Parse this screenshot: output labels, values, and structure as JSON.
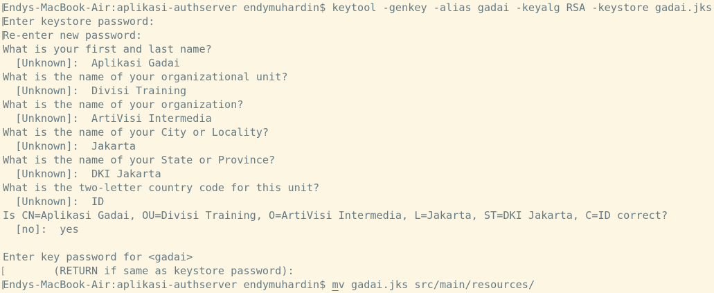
{
  "terminal": {
    "lines": [
      {
        "mark": "[",
        "text": "Endys-MacBook-Air:aplikasi-authserver endymuhardin$ keytool -genkey -alias gadai -keyalg RSA -keystore gadai.jks"
      },
      {
        "mark": "[",
        "text": "Enter keystore password:"
      },
      {
        "mark": "[",
        "text": "Re-enter new password:"
      },
      {
        "mark": "",
        "text": "What is your first and last name?"
      },
      {
        "mark": "",
        "text": "  [Unknown]:  Aplikasi Gadai"
      },
      {
        "mark": "",
        "text": "What is the name of your organizational unit?"
      },
      {
        "mark": "",
        "text": "  [Unknown]:  Divisi Training"
      },
      {
        "mark": "",
        "text": "What is the name of your organization?"
      },
      {
        "mark": "",
        "text": "  [Unknown]:  ArtiVisi Intermedia"
      },
      {
        "mark": "",
        "text": "What is the name of your City or Locality?"
      },
      {
        "mark": "",
        "text": "  [Unknown]:  Jakarta"
      },
      {
        "mark": "",
        "text": "What is the name of your State or Province?"
      },
      {
        "mark": "",
        "text": "  [Unknown]:  DKI Jakarta"
      },
      {
        "mark": "",
        "text": "What is the two-letter country code for this unit?"
      },
      {
        "mark": "",
        "text": "  [Unknown]:  ID"
      },
      {
        "mark": "",
        "text": "Is CN=Aplikasi Gadai, OU=Divisi Training, O=ArtiVisi Intermedia, L=Jakarta, ST=DKI Jakarta, C=ID correct?"
      },
      {
        "mark": "",
        "text": "  [no]:  yes"
      },
      {
        "mark": "",
        "text": ""
      },
      {
        "mark": "",
        "text": "Enter key password for <gadai>"
      },
      {
        "mark": "[",
        "text": "        (RETURN if same as keystore password):"
      }
    ],
    "last_prompt": {
      "mark": "[",
      "prompt": "Endys-MacBook-Air:aplikasi-authserver endymuhardin$ ",
      "command_head": "m",
      "command_rest": "v gadai.jks src/main/resources/"
    }
  }
}
